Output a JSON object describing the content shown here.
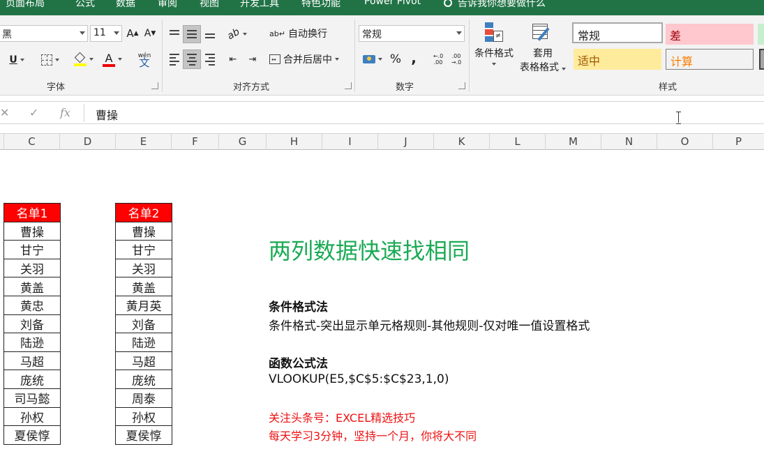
{
  "ribbon_tabs": [
    "页面布局",
    "公式",
    "数据",
    "审阅",
    "视图",
    "开发工具",
    "特色功能",
    "Power Pivot"
  ],
  "tell_me": "告诉我你想要做什么",
  "font": {
    "name": "黑",
    "size": "11",
    "grow_label": "A",
    "shrink_label": "A",
    "underline_label": "U",
    "font_color_label": "A",
    "wen_label": "wén",
    "wen_char": "文",
    "group_label": "字体"
  },
  "alignment": {
    "wrap_text": "自动换行",
    "merge_center": "合并后居中",
    "group_label": "对齐方式",
    "orient_label": "ab"
  },
  "number": {
    "format": "常规",
    "percent": "%",
    "comma": ",",
    "inc_decimal": "←.0 .00",
    "dec_decimal": ".00 →.0",
    "group_label": "数字"
  },
  "styles": {
    "conditional_format": "条件格式",
    "table_format_1": "套用",
    "table_format_2": "表格格式",
    "cells": [
      {
        "label": "常规",
        "bg": "#ffffff",
        "color": "#111111"
      },
      {
        "label": "差",
        "bg": "#ffc7ce",
        "color": "#9c0006"
      },
      {
        "label": "适中",
        "bg": "#ffeb9c",
        "color": "#9c5700"
      },
      {
        "label": "计算",
        "bg": "#f2f2f2",
        "color": "#fa7d00"
      }
    ],
    "group_label": "样式"
  },
  "formula_bar": {
    "cancel": "✕",
    "confirm": "✓",
    "fx": "fx",
    "content": "曹操"
  },
  "columns": [
    "C",
    "D",
    "E",
    "F",
    "G",
    "H",
    "I",
    "J",
    "K",
    "L",
    "M",
    "N",
    "O",
    "P"
  ],
  "list1": {
    "header": "名单1",
    "items": [
      "曹操",
      "甘宁",
      "关羽",
      "黄盖",
      "黄忠",
      "刘备",
      "陆逊",
      "马超",
      "庞统",
      "司马懿",
      "孙权",
      "夏侯惇"
    ]
  },
  "list2": {
    "header": "名单2",
    "items": [
      "曹操",
      "甘宁",
      "关羽",
      "黄盖",
      "黄月英",
      "刘备",
      "陆逊",
      "马超",
      "庞统",
      "周泰",
      "孙权",
      "夏侯惇"
    ]
  },
  "content": {
    "title": "两列数据快速找相同",
    "method1_title": "条件格式法",
    "method1_text": "条件格式-突出显示单元格规则-其他规则-仅对唯一值设置格式",
    "method2_title": "函数公式法",
    "method2_text": "VLOOKUP(E5,$C$5:$C$23,1,0)",
    "note1": "关注头条号：EXCEL精选技巧",
    "note2": "每天学习3分钟，坚持一个月，你将大不同"
  },
  "colors": {
    "tab_bar": "#217346",
    "header_fill": "#ff0000",
    "title_green": "#1aaa55",
    "note_red": "#ee1111"
  }
}
